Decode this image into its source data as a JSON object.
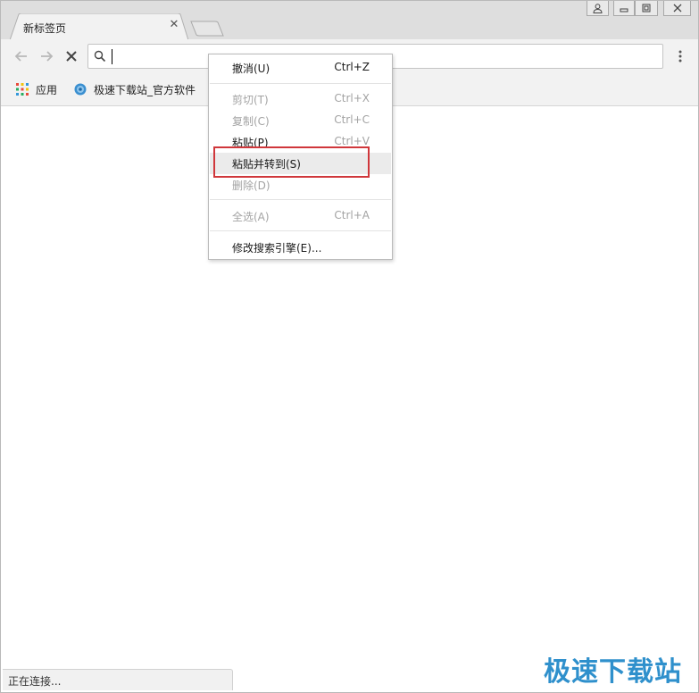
{
  "tab": {
    "title": "新标签页"
  },
  "toolbar": {
    "address_value": "",
    "address_placeholder": ""
  },
  "bookmarks": [
    {
      "label": "应用",
      "icon": "apps-grid-icon"
    },
    {
      "label": "极速下载站_官方软件",
      "icon": "site-globe-icon"
    }
  ],
  "context_menu": {
    "items": [
      {
        "label": "撤消(U)",
        "shortcut": "Ctrl+Z",
        "enabled": true
      },
      {
        "label": "剪切(T)",
        "shortcut": "Ctrl+X",
        "enabled": false
      },
      {
        "label": "复制(C)",
        "shortcut": "Ctrl+C",
        "enabled": false
      },
      {
        "label": "粘贴(P)",
        "shortcut": "Ctrl+V",
        "enabled": true
      },
      {
        "label": "粘贴并转到(S)",
        "shortcut": "",
        "enabled": true,
        "highlighted": true
      },
      {
        "label": "删除(D)",
        "shortcut": "",
        "enabled": false
      },
      {
        "label": "全选(A)",
        "shortcut": "Ctrl+A",
        "enabled": true
      },
      {
        "label": "修改搜索引擎(E)...",
        "shortcut": "",
        "enabled": true
      }
    ]
  },
  "status_bar": {
    "text": "正在连接..."
  },
  "watermark": {
    "text": "极速下载站"
  },
  "colors": {
    "highlight_border": "#d0373b",
    "watermark": "#1e87c8",
    "disabled_text": "#a3a3a3"
  }
}
